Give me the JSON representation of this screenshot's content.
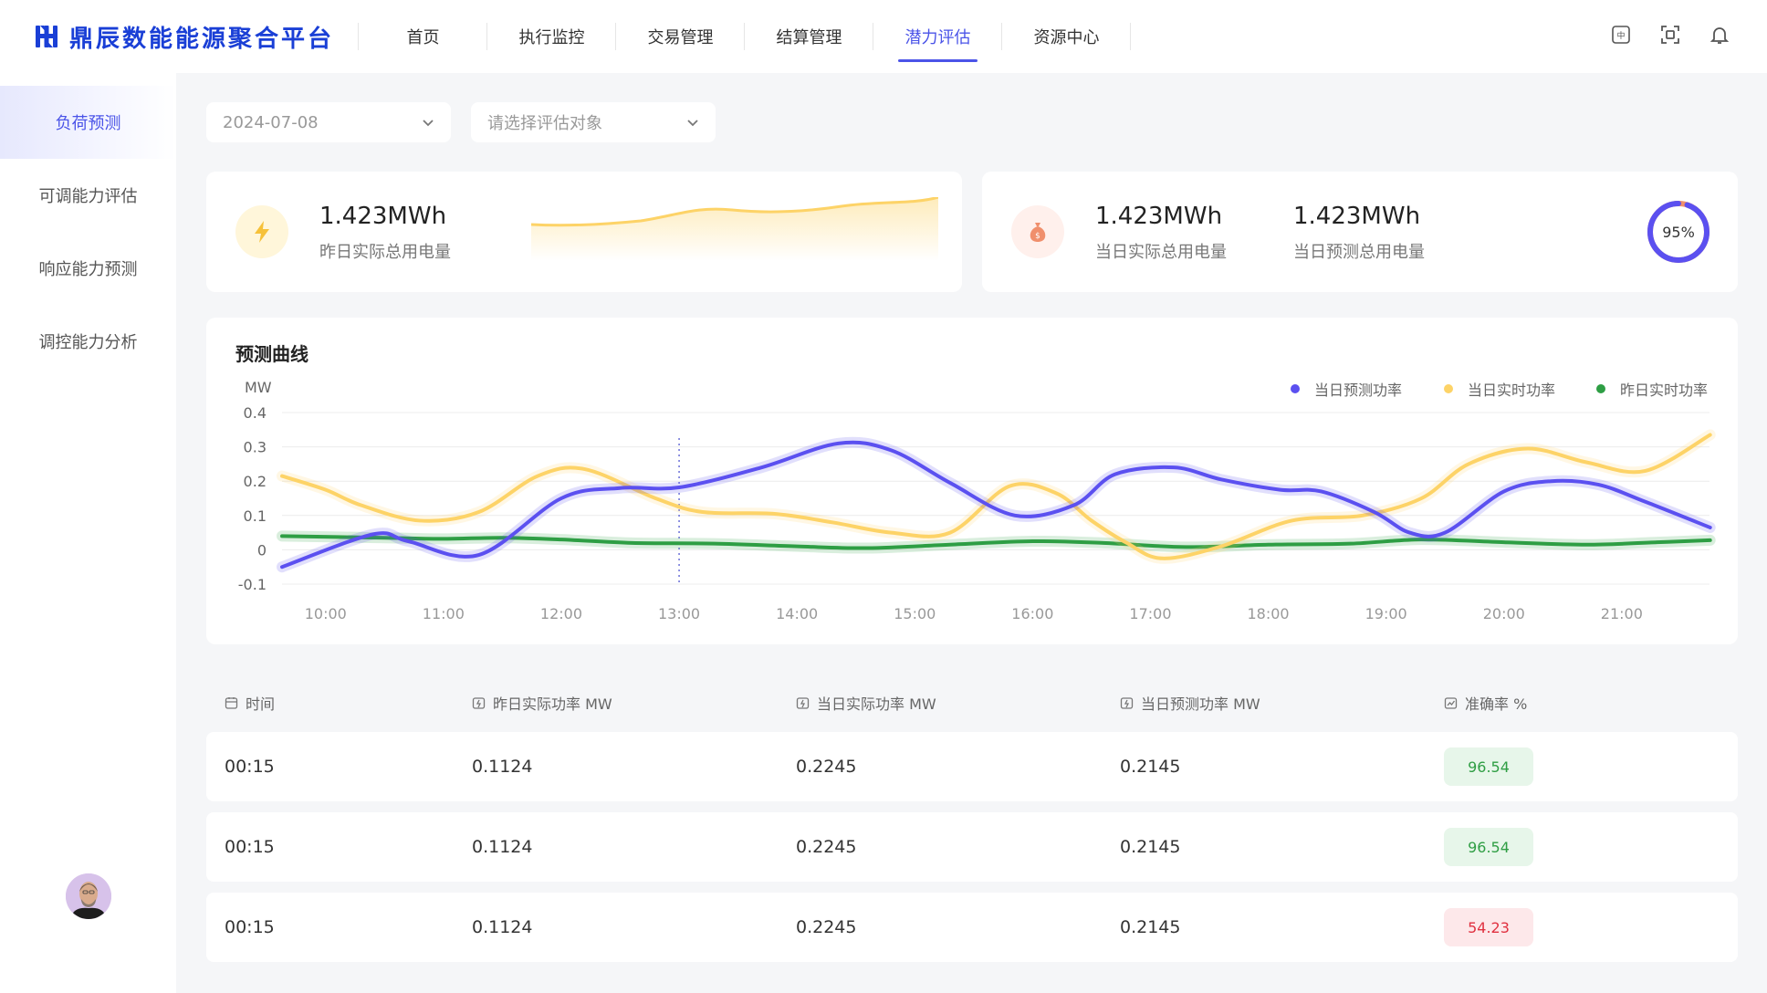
{
  "app": {
    "title": "鼎辰数能能源聚合平台"
  },
  "nav": {
    "items": [
      "首页",
      "执行监控",
      "交易管理",
      "结算管理",
      "潜力评估",
      "资源中心"
    ],
    "active_index": 4
  },
  "sidebar": {
    "items": [
      "负荷预测",
      "可调能力评估",
      "响应能力预测",
      "调控能力分析"
    ],
    "active_index": 0
  },
  "filters": {
    "date": "2024-07-08",
    "target_placeholder": "请选择评估对象"
  },
  "stats": {
    "yesterday": {
      "value": "1.423MWh",
      "label": "昨日实际总用电量"
    },
    "today_actual": {
      "value": "1.423MWh",
      "label": "当日实际总用电量"
    },
    "today_forecast": {
      "value": "1.423MWh",
      "label": "当日预测总用电量"
    },
    "accuracy": {
      "text": "95%",
      "value": 95
    }
  },
  "colors": {
    "accent": "#4b54e8",
    "forecast": "#5b50f0",
    "today_actual": "#fdd367",
    "yesterday_actual": "#2e9e44",
    "good": "#2f9e44",
    "bad": "#e03140"
  },
  "chart": {
    "title": "预测曲线"
  },
  "chart_data": {
    "type": "line",
    "title": "预测曲线",
    "ylabel": "MW",
    "ylim": [
      -0.1,
      0.4
    ],
    "yticks": [
      "0.4",
      "0.3",
      "0.2",
      "0.1",
      "0",
      "-0.1"
    ],
    "ytick_values": [
      0.4,
      0.3,
      0.2,
      0.1,
      0,
      -0.1
    ],
    "x_labels": [
      "10:00",
      "11:00",
      "12:00",
      "13:00",
      "14:00",
      "15:00",
      "16:00",
      "17:00",
      "18:00",
      "19:00",
      "20:00",
      "21:00"
    ],
    "x_label_hours": [
      10,
      11,
      12,
      13,
      14,
      15,
      16,
      17,
      18,
      19,
      20,
      21
    ],
    "xlim": [
      9.63,
      21.75
    ],
    "marker_x": 13.0,
    "grid": true,
    "legend": "top-right",
    "series": [
      {
        "name": "当日预测功率",
        "x": [
          9.63,
          10.4,
          10.7,
          11.3,
          12.0,
          12.5,
          13.0,
          13.7,
          14.35,
          14.8,
          15.3,
          15.85,
          16.35,
          16.7,
          17.2,
          17.6,
          18.1,
          18.45,
          18.9,
          19.2,
          19.5,
          20.0,
          20.4,
          20.8,
          21.2,
          21.75
        ],
        "y": [
          -0.05,
          0.045,
          0.025,
          -0.015,
          0.15,
          0.18,
          0.182,
          0.24,
          0.31,
          0.29,
          0.195,
          0.1,
          0.13,
          0.22,
          0.24,
          0.205,
          0.175,
          0.17,
          0.11,
          0.05,
          0.05,
          0.17,
          0.2,
          0.19,
          0.14,
          0.065
        ]
      },
      {
        "name": "当日实时功率",
        "x": [
          9.63,
          10.0,
          10.3,
          10.8,
          11.3,
          11.8,
          12.2,
          12.8,
          13.2,
          13.8,
          14.3,
          14.8,
          15.3,
          15.8,
          16.2,
          16.5,
          16.8,
          17.1,
          17.6,
          18.2,
          18.8,
          19.3,
          19.7,
          20.2,
          20.7,
          21.2,
          21.75
        ],
        "y": [
          0.215,
          0.175,
          0.13,
          0.085,
          0.11,
          0.215,
          0.235,
          0.15,
          0.11,
          0.105,
          0.08,
          0.05,
          0.05,
          0.185,
          0.165,
          0.085,
          0.02,
          -0.025,
          0.01,
          0.085,
          0.1,
          0.15,
          0.25,
          0.295,
          0.255,
          0.23,
          0.335
        ]
      },
      {
        "name": "昨日实时功率",
        "x": [
          9.63,
          10.5,
          11.0,
          11.5,
          12.0,
          12.6,
          13.3,
          14.0,
          14.6,
          15.3,
          16.0,
          16.6,
          17.3,
          18.0,
          18.7,
          19.3,
          20.0,
          20.7,
          21.3,
          21.75
        ],
        "y": [
          0.04,
          0.035,
          0.032,
          0.035,
          0.03,
          0.02,
          0.018,
          0.01,
          0.005,
          0.015,
          0.025,
          0.02,
          0.008,
          0.015,
          0.018,
          0.03,
          0.022,
          0.015,
          0.022,
          0.028
        ]
      }
    ]
  },
  "table": {
    "columns": [
      "时间",
      "昨日实际功率 MW",
      "当日实际功率 MW",
      "当日预测功率 MW",
      "准确率 %"
    ],
    "rows": [
      {
        "time": "00:15",
        "yesterday": "0.1124",
        "today_actual": "0.2245",
        "today_forecast": "0.2145",
        "accuracy": "96.54",
        "status": "good"
      },
      {
        "time": "00:15",
        "yesterday": "0.1124",
        "today_actual": "0.2245",
        "today_forecast": "0.2145",
        "accuracy": "96.54",
        "status": "good"
      },
      {
        "time": "00:15",
        "yesterday": "0.1124",
        "today_actual": "0.2245",
        "today_forecast": "0.2145",
        "accuracy": "54.23",
        "status": "bad"
      }
    ]
  }
}
